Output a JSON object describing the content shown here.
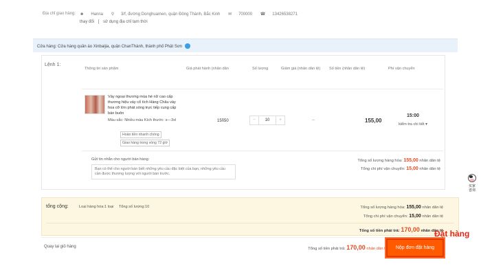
{
  "address": {
    "label": "Địa chỉ giao hàng:",
    "name": "Hanna",
    "street": "3/f, đường Donghuamen, quận Đông Thành, Bắc Kinh",
    "zip": "700000",
    "phone": "13426538271",
    "change_link": "thay đổi",
    "bracket": "[",
    "temp_link": "sử dụng địa chỉ tạm thời"
  },
  "store": {
    "text": "Cửa hàng: Cửa hàng quần áo Xinbaijia, quận ChanThành, thành phố Phật Sơn"
  },
  "order": {
    "number_label": "Lệnh 1:",
    "columns": {
      "info": "Thông tin sản phẩm",
      "price": "Giá phát hành (nhân dân",
      "qty": "Số lượng",
      "discount": "Giảm giá (nhân dân tệ)",
      "amount": "Số tiền (nhân dân tệ)",
      "shipping": "Phí vận chuyển"
    },
    "product": {
      "name": "Váy ngoại thương mùa hè nữ cao cấp thương hiệu váy cổ tích Hàng Châu váy hoa cỡ lớn phát sóng trực tiếp cung cấp bán buôn",
      "attrs": "Màu sắc: Nhiều màu Kích thước: s—3xl",
      "tag1": "Hoàn tiền nhanh chóng",
      "tag2": "Giao hàng trong vòng 72 giờ",
      "price": "15ñ50",
      "qty": "10",
      "minus": "−",
      "plus": "+",
      "discount": "--",
      "amount": "155,00",
      "shipping": "15:00",
      "shipping_detail": "kiểm tra chi tiết ▾"
    },
    "message_label": "Gửi tin nhắn cho người bán hàng:",
    "message_placeholder": "Bạn có thể cho người bán biết những yêu cầu đặc biệt của bạn, những yêu cầu cần được thương lượng với người bán trước.",
    "summary": {
      "goods_label": "Tổng số lượng hàng hóa:",
      "goods_value": "155,00",
      "ship_label": "Tổng chi phí vận chuyển:",
      "ship_value": "15,00",
      "unit": "nhân dân tệ"
    }
  },
  "total": {
    "label": "tổng cộng:",
    "types": "Loại hàng hóa:1 loại",
    "count": "Tổng số lượng:10",
    "goods_label": "Tổng số lượng hàng hóa:",
    "goods_value": "155,00",
    "ship_label": "Tổng chi phí vận chuyển:",
    "ship_value": "15,00",
    "pay_label": "Tổng số tiền phải trả:",
    "pay_value": "170,00",
    "unit": "nhân dân tệ"
  },
  "bottom": {
    "back": "Quay lại giỏ hàng",
    "pay_label": "Tổng số tiền phải trả:",
    "pay_value": "170,00",
    "unit": "nhân dân tệ",
    "submit": "Nộp đơn đặt hàng"
  },
  "annotation": "Đặt hàng",
  "helper": {
    "line1": "买家",
    "line2": "咨询"
  }
}
